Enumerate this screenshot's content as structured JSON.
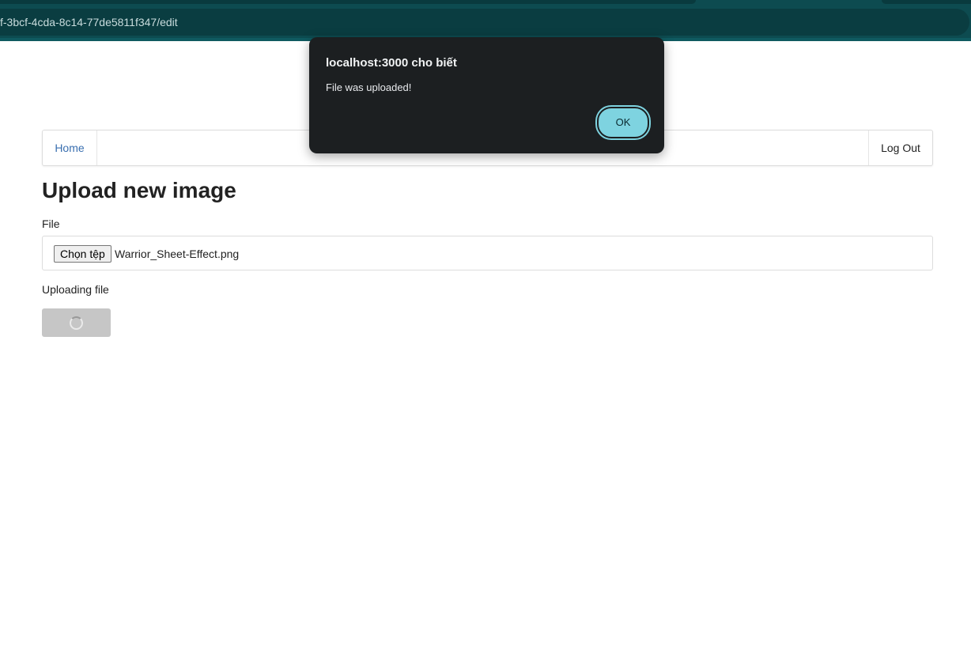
{
  "browser": {
    "url_text": "f-3bcf-4cda-8c14-77de5811f347/edit"
  },
  "nav": {
    "home_label": "Home",
    "logout_label": "Log Out"
  },
  "main": {
    "title": "Upload new image",
    "file_label": "File",
    "choose_button_label": "Chọn tệp",
    "chosen_file_name": "Warrior_Sheet-Effect.png",
    "status_text": "Uploading file",
    "upload_button_state": "loading"
  },
  "dialog": {
    "title": "localhost:3000 cho biết",
    "message": "File was uploaded!",
    "ok_label": "OK"
  },
  "colors": {
    "browser_chrome": "#0d4b50",
    "dialog_bg": "#1c1f21",
    "ok_button": "#7ed3e0",
    "nav_link": "#3a6fb0",
    "disabled_button": "#c6c6c6"
  },
  "icons": {
    "spinner": "loading-spinner-icon"
  }
}
